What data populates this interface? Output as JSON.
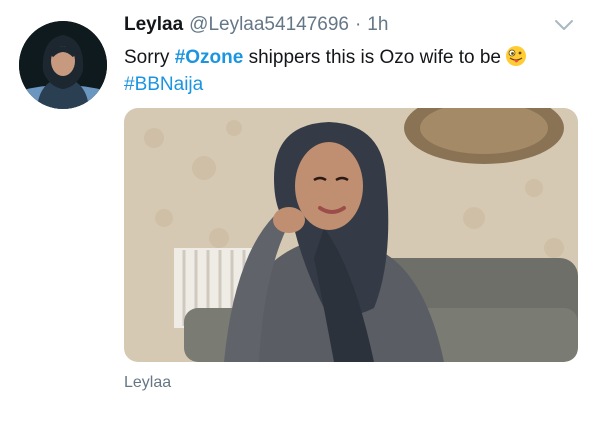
{
  "tweet": {
    "display_name": "Leylaa",
    "handle": "@Leylaa54147696",
    "separator": "·",
    "time": "1h",
    "text_sorry": "Sorry ",
    "hashtag_ozone": "#Ozone",
    "text_rest": " shippers this is Ozo wife to be",
    "hashtag_bbnaija": "#BBNaija",
    "emoji": "face-with-tongue-emoji",
    "caption": "Leylaa"
  },
  "colors": {
    "hashtag": "#1b95e0",
    "secondary_text": "#657786",
    "primary_text": "#14171a"
  },
  "icons": {
    "menu": "chevron-down-icon"
  }
}
